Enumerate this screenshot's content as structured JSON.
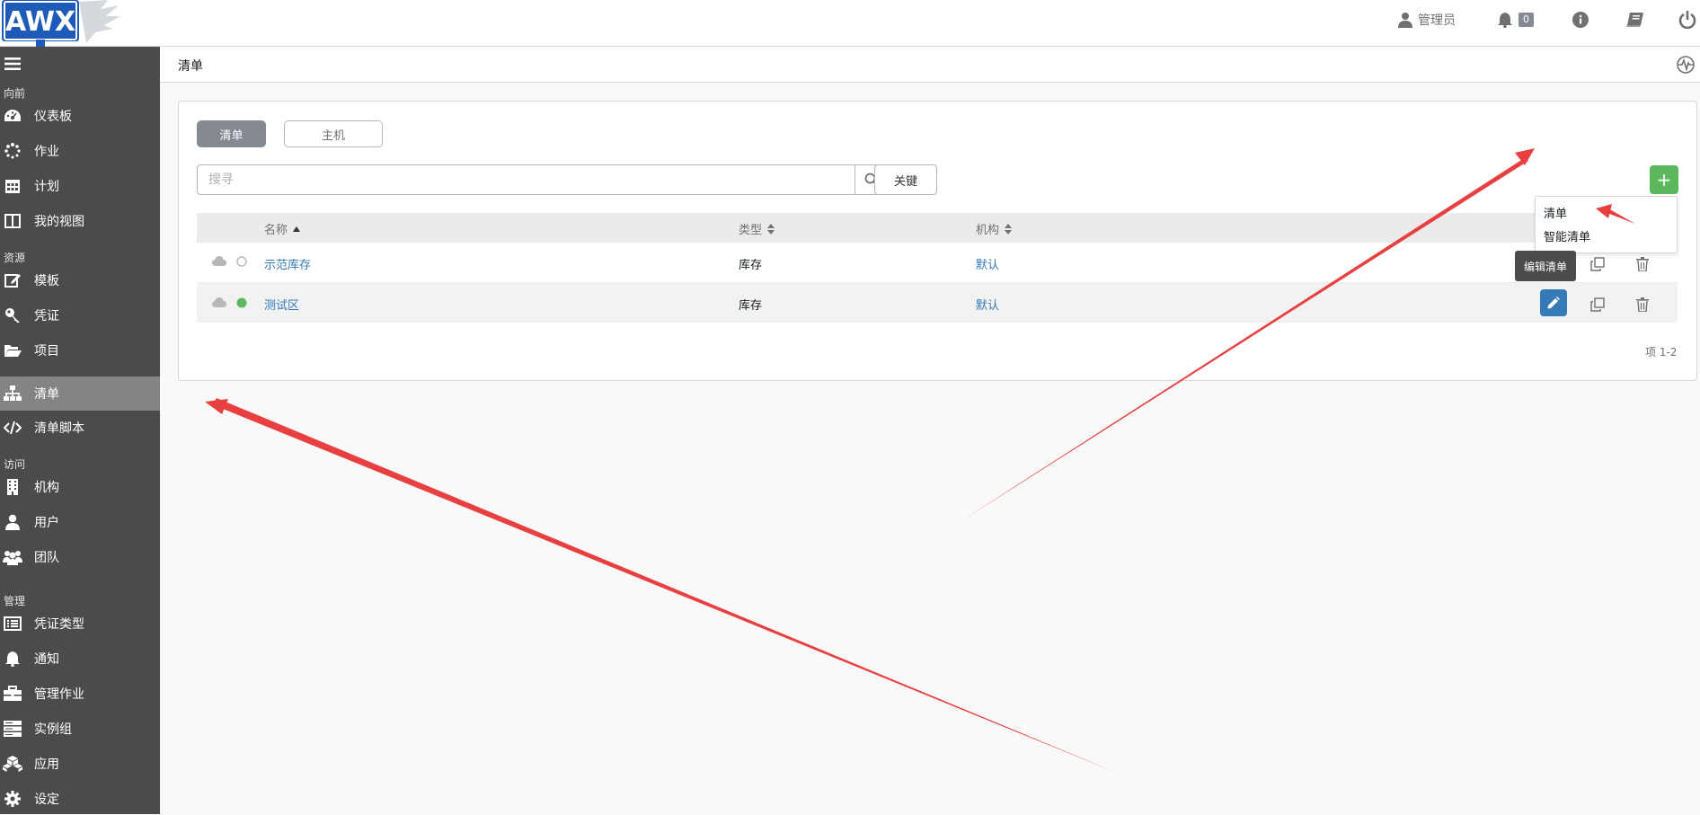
{
  "topbar": {
    "logo_text": "AWX",
    "user_label": "管理员",
    "notifications_count": "0"
  },
  "sidebar": {
    "sections": [
      "向前",
      "资源",
      "访问",
      "管理"
    ],
    "items": [
      {
        "label": "仪表板",
        "icon": "dashboard-icon"
      },
      {
        "label": "作业",
        "icon": "spinner-icon"
      },
      {
        "label": "计划",
        "icon": "calendar-icon"
      },
      {
        "label": "我的视图",
        "icon": "columns-icon"
      },
      {
        "label": "模板",
        "icon": "edit-icon"
      },
      {
        "label": "凭证",
        "icon": "key-icon"
      },
      {
        "label": "项目",
        "icon": "folder-open-icon"
      },
      {
        "label": "清单",
        "icon": "sitemap-icon",
        "active": true
      },
      {
        "label": "清单脚本",
        "icon": "code-icon"
      },
      {
        "label": "机构",
        "icon": "building-icon"
      },
      {
        "label": "用户",
        "icon": "user-icon"
      },
      {
        "label": "团队",
        "icon": "users-icon"
      },
      {
        "label": "凭证类型",
        "icon": "list-alt-icon"
      },
      {
        "label": "通知",
        "icon": "bell-icon"
      },
      {
        "label": "管理作业",
        "icon": "briefcase-icon"
      },
      {
        "label": "实例组",
        "icon": "server-icon"
      },
      {
        "label": "应用",
        "icon": "cubes-icon"
      },
      {
        "label": "设定",
        "icon": "cog-icon"
      }
    ]
  },
  "breadcrumb": {
    "current": "清单"
  },
  "panel": {
    "tabs": [
      {
        "label": "清单",
        "selected": true
      },
      {
        "label": "主机",
        "selected": false
      }
    ],
    "search_placeholder": "搜寻",
    "key_button": "关键",
    "add_button": "+",
    "columns": [
      "名称",
      "类型",
      "机构"
    ],
    "rows": [
      {
        "name": "示范库存",
        "type": "库存",
        "org": "默认",
        "status": "none"
      },
      {
        "name": "测试区",
        "type": "库存",
        "org": "默认",
        "status": "success"
      }
    ],
    "pager": "项  1-2"
  },
  "dropdown": {
    "items": [
      "清单",
      "智能清单"
    ]
  },
  "tooltip": {
    "text": "编辑清单"
  },
  "colors": {
    "sidebar_bg": "#4b4b4b",
    "active_item": "#848484",
    "add_button": "#5cb85c",
    "link": "#337ab7",
    "annotation_arrow": "#e84040"
  }
}
